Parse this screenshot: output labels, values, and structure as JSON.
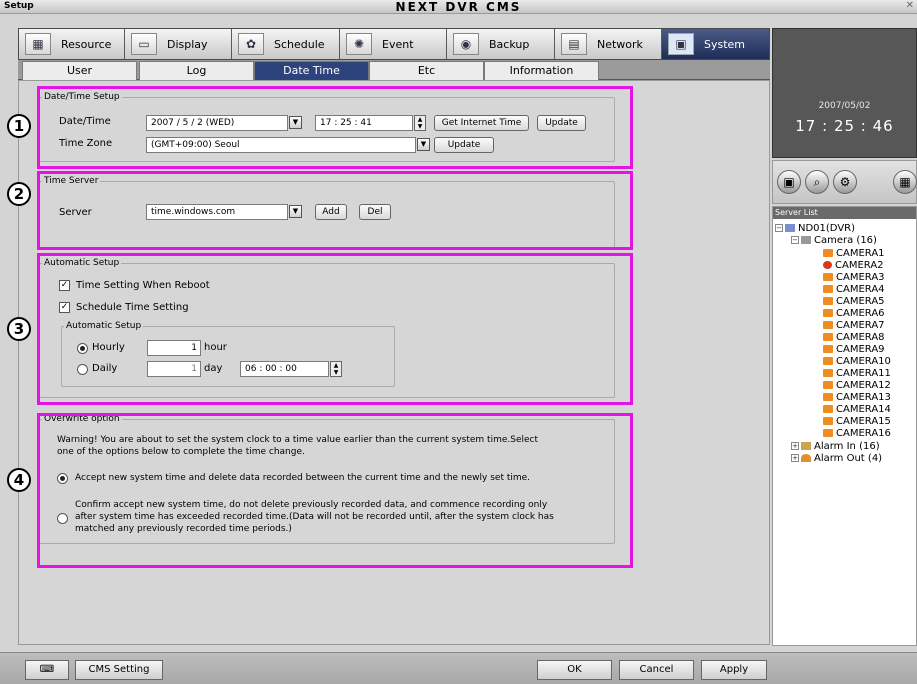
{
  "window": {
    "label": "Setup",
    "title": "NEXT DVR CMS",
    "close": "✕"
  },
  "main_tabs": [
    {
      "label": "Resource",
      "icon": "resource-icon"
    },
    {
      "label": "Display",
      "icon": "display-icon"
    },
    {
      "label": "Schedule",
      "icon": "schedule-icon"
    },
    {
      "label": "Event",
      "icon": "event-icon"
    },
    {
      "label": "Backup",
      "icon": "backup-icon"
    },
    {
      "label": "Network",
      "icon": "network-icon"
    },
    {
      "label": "System",
      "icon": "system-icon",
      "active": true
    }
  ],
  "sub_tabs": [
    "User",
    "Log",
    "Date Time",
    "Etc",
    "Information"
  ],
  "sub_tab_active": "Date Time",
  "callouts": [
    "1",
    "2",
    "3",
    "4"
  ],
  "datetime_setup": {
    "legend": "Date/Time Setup",
    "date_label": "Date/Time",
    "date_value": "2007  /  5  /  2   (WED)",
    "time_value": "17  :  25  :  41",
    "get_internet_time_btn": "Get Internet Time",
    "update_btn": "Update",
    "timezone_label": "Time Zone",
    "timezone_value": "(GMT+09:00) Seoul",
    "tz_update_btn": "Update"
  },
  "time_server": {
    "legend": "Time Server",
    "server_label": "Server",
    "server_value": "time.windows.com",
    "add_btn": "Add",
    "del_btn": "Del"
  },
  "automatic_setup": {
    "legend": "Automatic Setup",
    "reboot_label": "Time Setting When Reboot",
    "reboot_checked": true,
    "schedule_label": "Schedule Time Setting",
    "schedule_checked": true,
    "inner_legend": "Automatic Setup",
    "hourly_label": "Hourly",
    "hourly_value": "1",
    "hourly_unit": "hour",
    "daily_label": "Daily",
    "daily_value": "1",
    "daily_unit": "day",
    "daily_time": "06  :  00  :  00",
    "selected": "Hourly"
  },
  "overwrite": {
    "legend": "Overwrite option",
    "warning_line1": "Warning! You are about to set the system clock to a time value earlier than the current system time.Select",
    "warning_line2": "one of the options below to complete the time change.",
    "option1": "Accept new system time and delete data recorded between the current time and the newly set time.",
    "option2_line1": "Confirm accept new system time, do not delete previously recorded data, and commence recording only",
    "option2_line2": "after system time has exceeded recorded time.(Data will not be recorded until, after the system clock has",
    "option2_line3": "matched any previously recorded time periods.)",
    "selected": 1
  },
  "bottom": {
    "keyboard_icon": "keyboard-icon",
    "cms_setting": "CMS Setting",
    "ok": "OK",
    "cancel": "Cancel",
    "apply": "Apply"
  },
  "clock": {
    "date": "2007/05/02",
    "time": "17 : 25 : 46"
  },
  "server_list": {
    "header": "Server List",
    "dvr_name": "ND01(DVR)",
    "camera_group": "Camera (16)",
    "cameras": [
      "CAMERA1",
      "CAMERA2",
      "CAMERA3",
      "CAMERA4",
      "CAMERA5",
      "CAMERA6",
      "CAMERA7",
      "CAMERA8",
      "CAMERA9",
      "CAMERA10",
      "CAMERA11",
      "CAMERA12",
      "CAMERA13",
      "CAMERA14",
      "CAMERA15",
      "CAMERA16"
    ],
    "alarm_in": "Alarm In (16)",
    "alarm_out": "Alarm Out (4)"
  },
  "colors": {
    "highlight": "#e414e4",
    "active_tab": "#2c437c",
    "clock_bg": "#575757"
  }
}
